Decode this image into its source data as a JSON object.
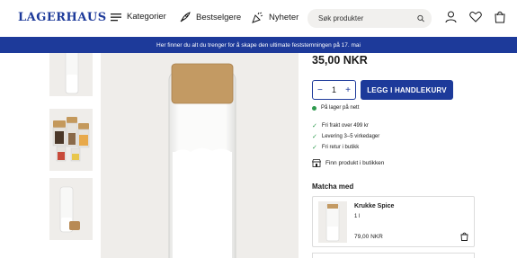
{
  "header": {
    "logo": "LAGERHAUS",
    "nav": {
      "categories": "Kategorier",
      "bestsellers": "Bestselgere",
      "news": "Nyheter"
    },
    "search": {
      "placeholder": "Søk produkter"
    },
    "icons": [
      "user-icon",
      "heart-icon",
      "bag-icon"
    ]
  },
  "banner": {
    "text": "Her finner du alt du trenger for å skape den ultimate feststemningen på 17. mai"
  },
  "product": {
    "price": "35,00 NKR",
    "quantity": "1",
    "add_to_cart": "LEGG I HANDLEKURV",
    "stock": "På lager på nett",
    "usps": [
      "Fri frakt over 499 kr",
      "Levering 3–5 virkedager",
      "Fri retur i butikk"
    ],
    "find_in_store": "Finn produkt i butikken",
    "colors": {
      "accent": "#1d3a9a",
      "in_stock": "#2e9a4e"
    }
  },
  "match": {
    "title": "Matcha med",
    "item": {
      "name": "Krukke Spice",
      "size": "1 l",
      "price": "79,00 NKR"
    }
  }
}
